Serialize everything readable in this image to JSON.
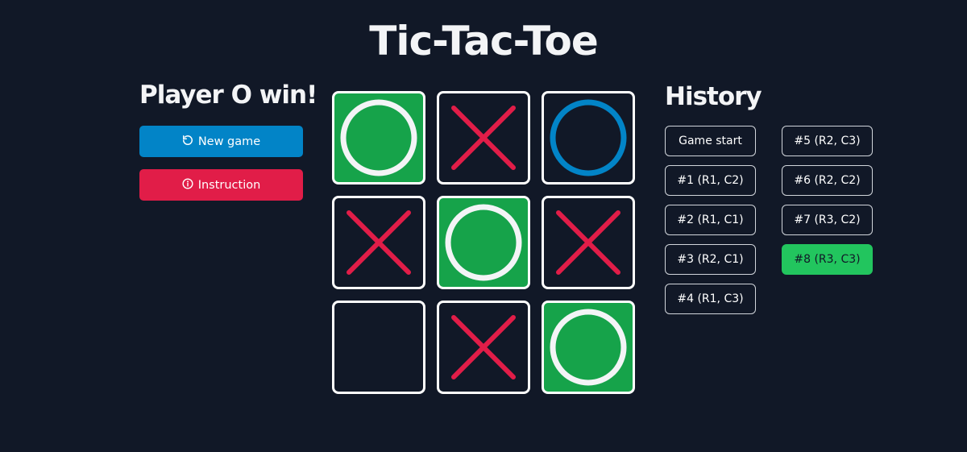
{
  "title": "Tic-Tac-Toe",
  "status": "Player O win!",
  "buttons": {
    "new_game": {
      "label": "New game",
      "icon": "rotate-ccw-icon"
    },
    "instruction": {
      "label": "Instruction",
      "icon": "info-circle-icon"
    }
  },
  "colors": {
    "background": "#111827",
    "x_mark": "#e11d48",
    "o_mark": "#0284c7",
    "win_cell": "#16a34a",
    "win_mark": "#f3f4f6",
    "active_history": "#22c55e"
  },
  "board": [
    {
      "row": 1,
      "col": 1,
      "mark": "O",
      "win": true
    },
    {
      "row": 1,
      "col": 2,
      "mark": "X",
      "win": false
    },
    {
      "row": 1,
      "col": 3,
      "mark": "O",
      "win": false
    },
    {
      "row": 2,
      "col": 1,
      "mark": "X",
      "win": false
    },
    {
      "row": 2,
      "col": 2,
      "mark": "O",
      "win": true
    },
    {
      "row": 2,
      "col": 3,
      "mark": "X",
      "win": false
    },
    {
      "row": 3,
      "col": 1,
      "mark": "",
      "win": false
    },
    {
      "row": 3,
      "col": 2,
      "mark": "X",
      "win": false
    },
    {
      "row": 3,
      "col": 3,
      "mark": "O",
      "win": true
    }
  ],
  "history": {
    "title": "History",
    "items": [
      {
        "label": "Game start",
        "active": false
      },
      {
        "label": "#1 (R1, C2)",
        "active": false
      },
      {
        "label": "#2 (R1, C1)",
        "active": false
      },
      {
        "label": "#3 (R2, C1)",
        "active": false
      },
      {
        "label": "#4 (R1, C3)",
        "active": false
      },
      {
        "label": "#5 (R2, C3)",
        "active": false
      },
      {
        "label": "#6 (R2, C2)",
        "active": false
      },
      {
        "label": "#7 (R3, C2)",
        "active": false
      },
      {
        "label": "#8 (R3, C3)",
        "active": true
      }
    ]
  }
}
